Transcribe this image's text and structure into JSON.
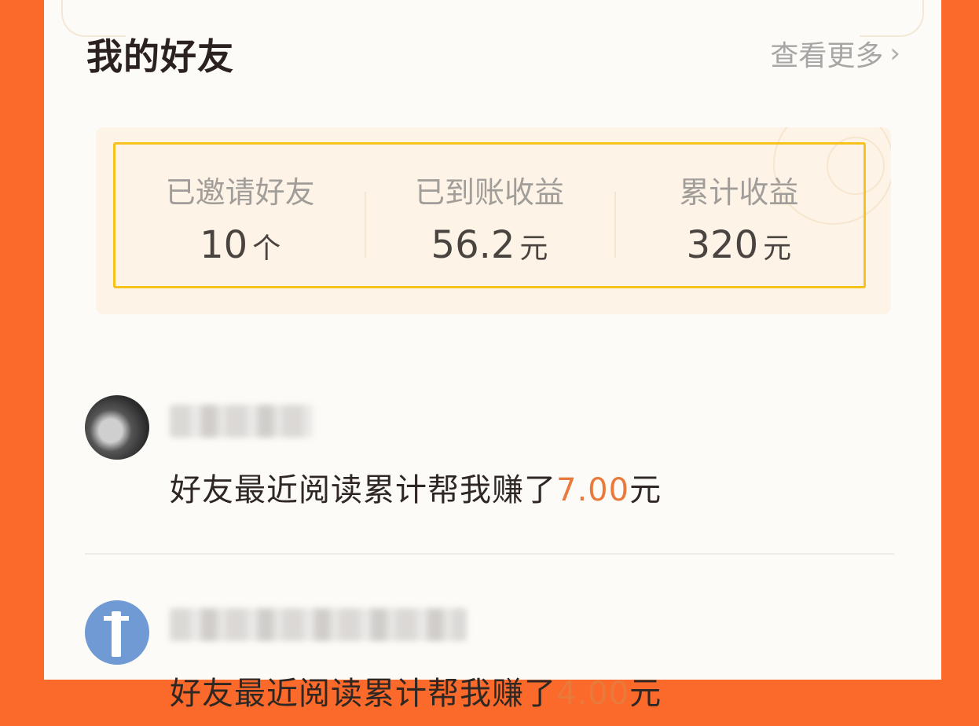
{
  "header": {
    "title": "我的好友",
    "more_label": "查看更多",
    "more_chevron": "›"
  },
  "stats": [
    {
      "label": "已邀请好友",
      "value": "10",
      "unit": "个"
    },
    {
      "label": "已到账收益",
      "value": "56.2",
      "unit": "元"
    },
    {
      "label": "累计收益",
      "value": "320",
      "unit": "元"
    }
  ],
  "friends": [
    {
      "name": "",
      "earn_prefix": "好友最近阅读累计帮我赚了",
      "amount": "7.00",
      "unit": "元",
      "avatar": "photo-avatar"
    },
    {
      "name": "",
      "earn_prefix": "好友最近阅读累计帮我赚了",
      "amount": "4.00",
      "unit": "元",
      "avatar": "blue-avatar"
    }
  ],
  "colors": {
    "background": "#fb6a2a",
    "accent": "#e97a3c",
    "highlight_border": "#f6c21c"
  }
}
